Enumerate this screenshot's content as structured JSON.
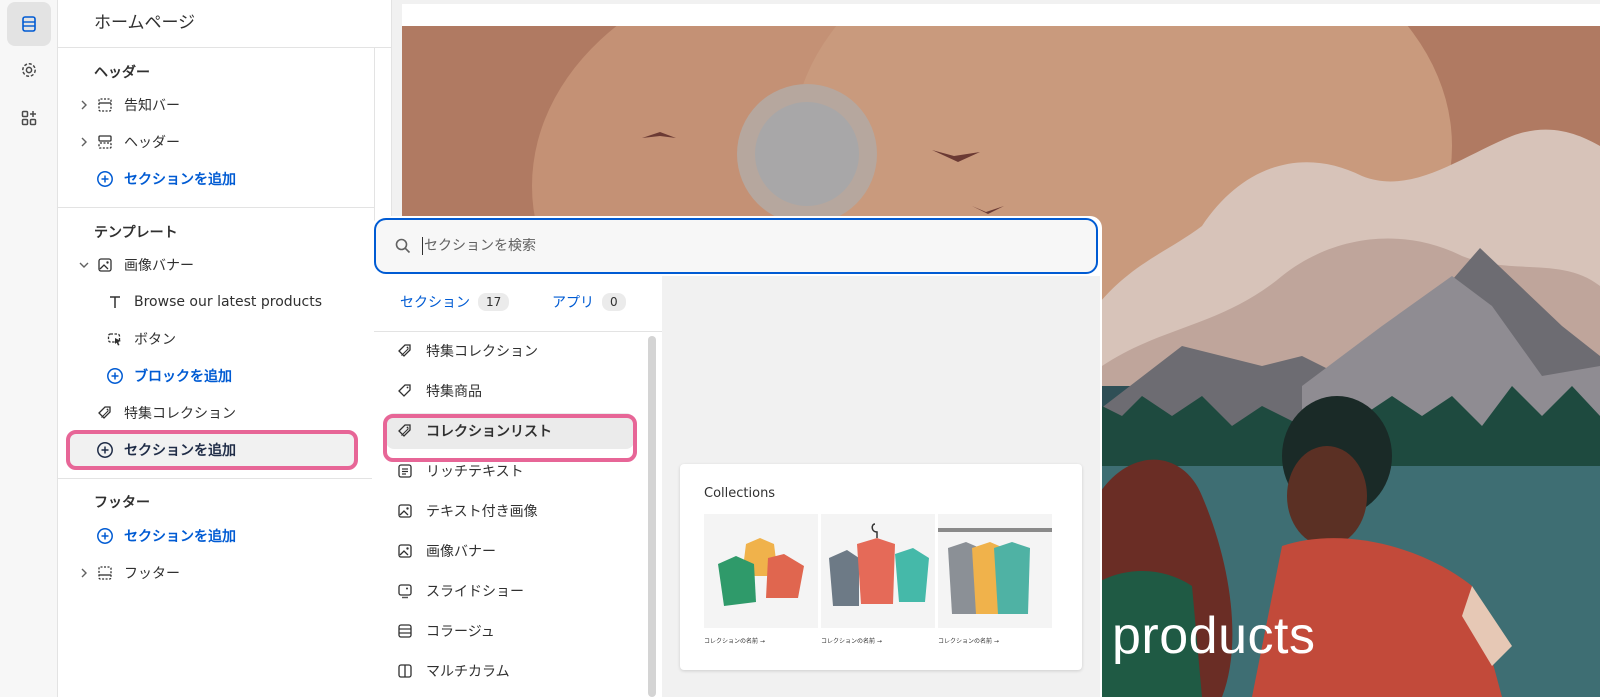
{
  "sidebar": {
    "title": "ホームページ",
    "groups": {
      "header": "ヘッダー",
      "template": "テンプレート",
      "footer": "フッター"
    },
    "items": {
      "announcement_bar": "告知バー",
      "header": "ヘッダー",
      "header_add_section": "セクションを追加",
      "image_banner": "画像バナー",
      "text_block": "Browse our latest products",
      "button_block": "ボタン",
      "add_block": "ブロックを追加",
      "featured_collection": "特集コレクション",
      "template_add_section": "セクションを追加",
      "footer_add_section": "セクションを追加",
      "footer": "フッター"
    }
  },
  "picker": {
    "search_placeholder": "セクションを検索",
    "tabs": [
      {
        "label": "セクション",
        "count": "17"
      },
      {
        "label": "アプリ",
        "count": "0"
      }
    ],
    "list": [
      {
        "label": "特集コレクション",
        "icon": "collection-tag-icon"
      },
      {
        "label": "特集商品",
        "icon": "tag-icon"
      },
      {
        "label": "コレクションリスト",
        "icon": "collection-tag-icon"
      },
      {
        "label": "リッチテキスト",
        "icon": "text-block-icon"
      },
      {
        "label": "テキスト付き画像",
        "icon": "image-icon"
      },
      {
        "label": "画像バナー",
        "icon": "image-icon"
      },
      {
        "label": "スライドショー",
        "icon": "slideshow-icon"
      },
      {
        "label": "コラージュ",
        "icon": "collage-icon"
      },
      {
        "label": "マルチカラム",
        "icon": "columns-icon"
      }
    ],
    "selected_index": 2,
    "preview": {
      "title": "Collections",
      "captions": [
        "コレクションの名前 →",
        "コレクションの名前 →",
        "コレクションの名前 →"
      ]
    }
  },
  "hero": {
    "visible_text": "products"
  },
  "colors": {
    "accent": "#005bd3",
    "highlight": "#e76697"
  }
}
